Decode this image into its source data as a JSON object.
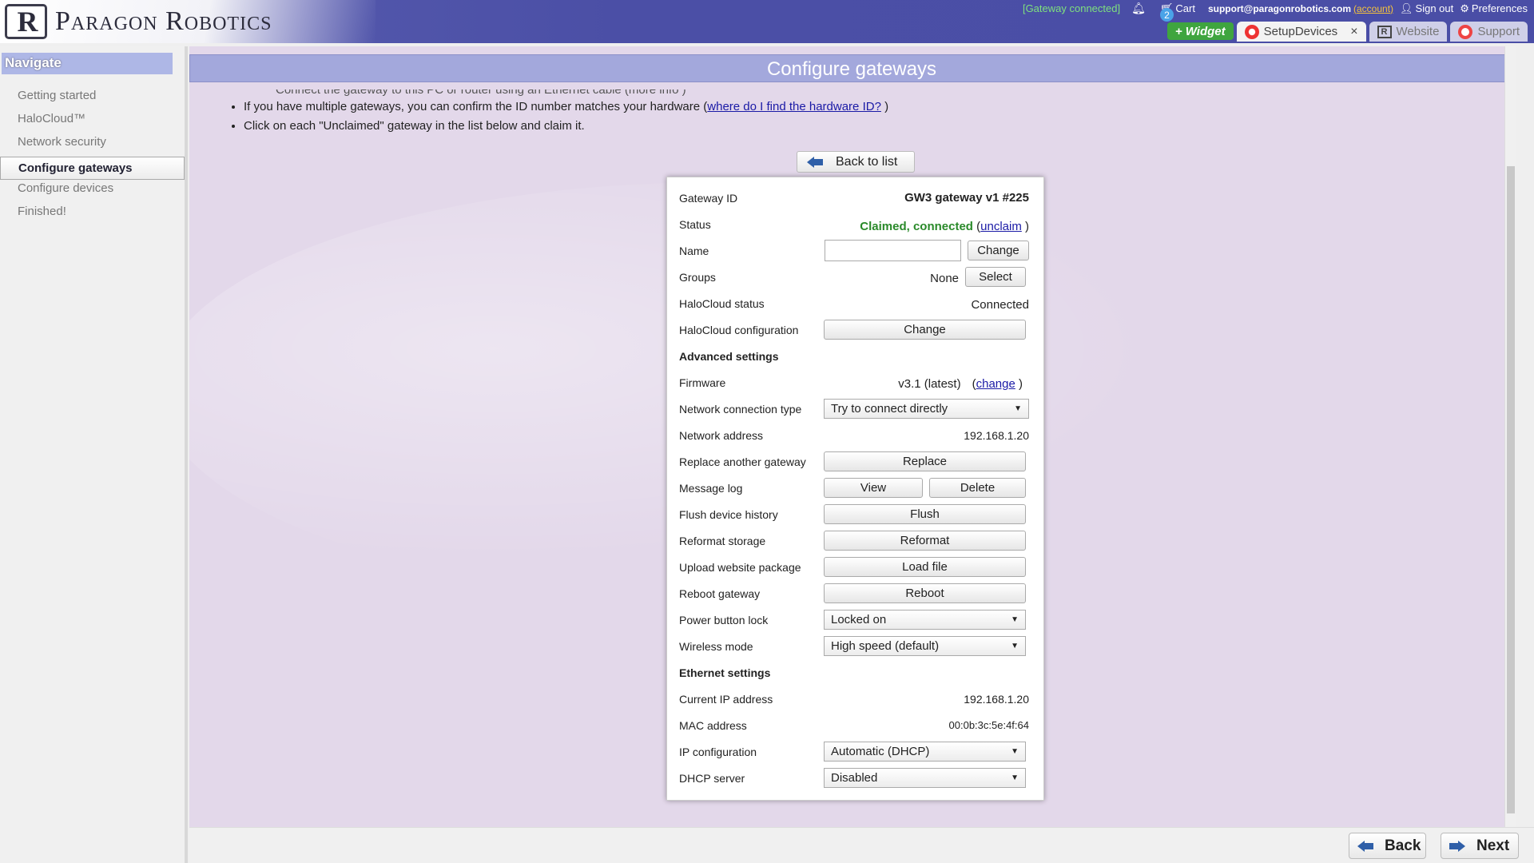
{
  "app": {
    "logo_mark": "R",
    "logo_text": "Paragon Robotics"
  },
  "topbar": {
    "gateway_status": "[Gateway connected]",
    "notification_count": "2",
    "cart_label": "Cart",
    "email": "support@paragonrobotics.com",
    "account_label": "(account)",
    "sign_out_label": "Sign out",
    "preferences_label": "Preferences"
  },
  "tabs": [
    {
      "label": "+ Widget"
    },
    {
      "label": "SetupDevices",
      "close": "×"
    },
    {
      "label": "Website"
    },
    {
      "label": "Support"
    }
  ],
  "sidebar": {
    "title": "Navigate",
    "items": [
      {
        "label": "Getting started"
      },
      {
        "label": "HaloCloud™"
      },
      {
        "label": "Network security"
      },
      {
        "label": "Configure gateways"
      },
      {
        "label": "Configure devices"
      },
      {
        "label": "Finished!"
      }
    ]
  },
  "main": {
    "title": "Configure gateways",
    "intro_cut": "Connect the gateway to this PC or router using an Ethernet cable (more info )",
    "intro1_prefix": "If you have multiple gateways, you can confirm the ID number matches your hardware (",
    "intro1_link": "where do I find the hardware ID?",
    "intro1_suffix": " )",
    "intro2": "Click on each \"Unclaimed\" gateway in the list below and claim it.",
    "back_to_list": "Back to list"
  },
  "gateway": {
    "id_label": "Gateway ID",
    "id_value": "GW3 gateway v1 #225",
    "status_label": "Status",
    "status_value": "Claimed, connected",
    "unclaim_link": "unclaim",
    "name_label": "Name",
    "name_value": "",
    "change_label": "Change",
    "groups_label": "Groups",
    "groups_value": "None",
    "select_label": "Select",
    "halocloud_status_label": "HaloCloud status",
    "halocloud_status_value": "Connected",
    "halocloud_config_label": "HaloCloud configuration",
    "halocloud_config_button": "Change",
    "advanced_header": "Advanced settings",
    "firmware_label": "Firmware",
    "firmware_value": "v3.1 (latest)",
    "firmware_change_link": "change",
    "netconn_label": "Network connection type",
    "netconn_value": "Try to connect directly",
    "netaddr_label": "Network address",
    "netaddr_value": "192.168.1.20",
    "replace_label": "Replace another gateway",
    "replace_button": "Replace",
    "msglog_label": "Message log",
    "view_button": "View",
    "delete_button": "Delete",
    "flush_label": "Flush device history",
    "flush_button": "Flush",
    "reformat_label": "Reformat storage",
    "reformat_button": "Reformat",
    "upload_label": "Upload website package",
    "upload_button": "Load file",
    "reboot_label": "Reboot gateway",
    "reboot_button": "Reboot",
    "powerlock_label": "Power button lock",
    "powerlock_value": "Locked on",
    "wireless_label": "Wireless mode",
    "wireless_value": "High speed (default)",
    "ethernet_header": "Ethernet settings",
    "curip_label": "Current IP address",
    "curip_value": "192.168.1.20",
    "mac_label": "MAC address",
    "mac_value": "00:0b:3c:5e:4f:64",
    "ipconfig_label": "IP configuration",
    "ipconfig_value": "Automatic (DHCP)",
    "dhcp_label": "DHCP server",
    "dhcp_value": "Disabled"
  },
  "footer": {
    "back_label": "Back",
    "next_label": "Next"
  }
}
